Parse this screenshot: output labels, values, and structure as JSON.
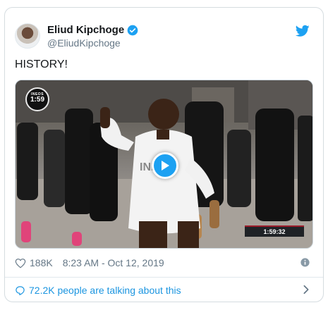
{
  "tweet": {
    "author_name": "Eliud Kipchoge",
    "author_handle": "@EliudKipchoge",
    "text": "HISTORY!",
    "likes": "188K",
    "timestamp": "8:23 AM - Oct 12, 2019",
    "talking": "72.2K people are talking about this"
  },
  "media": {
    "badge_brand": "INEOS",
    "badge_time": "1:59",
    "timer": "1:59:32",
    "jersey_text": "INEOS"
  },
  "colors": {
    "accent": "#1da1f2",
    "link": "#1b95e0",
    "secondary_text": "#657786",
    "primary_text": "#14171a"
  },
  "icons": {
    "verified": "verified-badge-icon",
    "bird": "twitter-bird-icon",
    "heart": "heart-icon",
    "info": "info-icon",
    "bubble": "speech-bubble-icon",
    "chevron": "chevron-right-icon",
    "play": "play-icon"
  }
}
